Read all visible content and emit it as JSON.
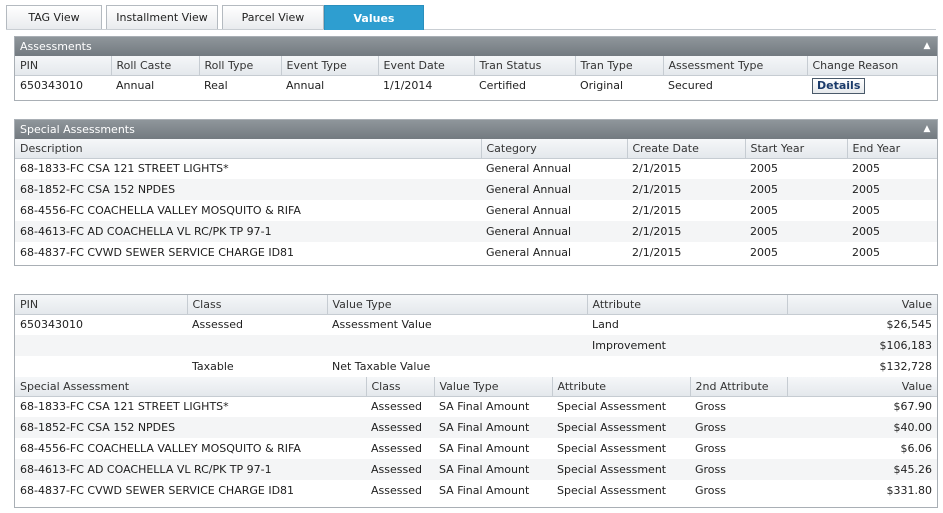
{
  "tabs": [
    {
      "label": "TAG View"
    },
    {
      "label": "Installment View"
    },
    {
      "label": "Parcel View"
    },
    {
      "label": "Values"
    }
  ],
  "assessments": {
    "title": "Assessments",
    "columns": [
      "PIN",
      "Roll Caste",
      "Roll Type",
      "Event Type",
      "Event Date",
      "Tran Status",
      "Tran Type",
      "Assessment Type",
      "Change Reason"
    ],
    "row": {
      "pin": "650343010",
      "roll_caste": "Annual",
      "roll_type": "Real",
      "event_type": "Annual",
      "event_date": "1/1/2014",
      "tran_status": "Certified",
      "tran_type": "Original",
      "assessment_type": "Secured",
      "change_reason": "Details"
    }
  },
  "special_assessments": {
    "title": "Special Assessments",
    "columns": [
      "Description",
      "Category",
      "Create Date",
      "Start Year",
      "End Year"
    ],
    "rows": [
      {
        "description": "68-1833-FC CSA 121 STREET LIGHTS*",
        "category": "General Annual",
        "create_date": "2/1/2015",
        "start_year": "2005",
        "end_year": "2005"
      },
      {
        "description": "68-1852-FC CSA 152 NPDES",
        "category": "General Annual",
        "create_date": "2/1/2015",
        "start_year": "2005",
        "end_year": "2005"
      },
      {
        "description": "68-4556-FC COACHELLA VALLEY MOSQUITO & RIFA",
        "category": "General Annual",
        "create_date": "2/1/2015",
        "start_year": "2005",
        "end_year": "2005"
      },
      {
        "description": "68-4613-FC AD COACHELLA VL RC/PK TP 97-1",
        "category": "General Annual",
        "create_date": "2/1/2015",
        "start_year": "2005",
        "end_year": "2005"
      },
      {
        "description": "68-4837-FC CVWD SEWER SERVICE CHARGE ID81",
        "category": "General Annual",
        "create_date": "2/1/2015",
        "start_year": "2005",
        "end_year": "2005"
      }
    ]
  },
  "values": {
    "columns": [
      "PIN",
      "Class",
      "Value Type",
      "Attribute",
      "Value"
    ],
    "rows": [
      {
        "pin": "650343010",
        "class": "Assessed",
        "value_type": "Assessment Value",
        "attribute": "Land",
        "value": "$26,545"
      },
      {
        "pin": "",
        "class": "",
        "value_type": "",
        "attribute": "Improvement",
        "value": "$106,183"
      },
      {
        "pin": "",
        "class": "Taxable",
        "value_type": "Net Taxable Value",
        "attribute": "",
        "value": "$132,728"
      }
    ]
  },
  "sa_values": {
    "columns": [
      "Special Assessment",
      "Class",
      "Value Type",
      "Attribute",
      "2nd Attribute",
      "Value"
    ],
    "rows": [
      {
        "special_assessment": "68-1833-FC CSA 121 STREET LIGHTS*",
        "class": "Assessed",
        "value_type": "SA Final Amount",
        "attribute": "Special Assessment",
        "second_attribute": "Gross",
        "value": "$67.90"
      },
      {
        "special_assessment": "68-1852-FC CSA 152 NPDES",
        "class": "Assessed",
        "value_type": "SA Final Amount",
        "attribute": "Special Assessment",
        "second_attribute": "Gross",
        "value": "$40.00"
      },
      {
        "special_assessment": "68-4556-FC COACHELLA VALLEY MOSQUITO & RIFA",
        "class": "Assessed",
        "value_type": "SA Final Amount",
        "attribute": "Special Assessment",
        "second_attribute": "Gross",
        "value": "$6.06"
      },
      {
        "special_assessment": "68-4613-FC AD COACHELLA VL RC/PK TP 97-1",
        "class": "Assessed",
        "value_type": "SA Final Amount",
        "attribute": "Special Assessment",
        "second_attribute": "Gross",
        "value": "$45.26"
      },
      {
        "special_assessment": "68-4837-FC CVWD SEWER SERVICE CHARGE ID81",
        "class": "Assessed",
        "value_type": "SA Final Amount",
        "attribute": "Special Assessment",
        "second_attribute": "Gross",
        "value": "$331.80"
      }
    ]
  },
  "icons": {
    "collapse": "double-chevron-up-icon"
  },
  "colors": {
    "active_tab": "#2e9ed0",
    "header_bar": "#7f868c"
  }
}
